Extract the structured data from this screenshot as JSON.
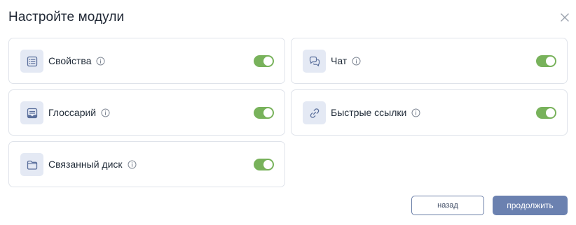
{
  "dialog": {
    "title": "Настройте модули"
  },
  "modules": [
    {
      "label": "Свойства",
      "icon": "list-icon",
      "enabled": true
    },
    {
      "label": "Чат",
      "icon": "chat-icon",
      "enabled": true
    },
    {
      "label": "Глоссарий",
      "icon": "glossary-icon",
      "enabled": true
    },
    {
      "label": "Быстрые ссылки",
      "icon": "link-icon",
      "enabled": true
    },
    {
      "label": "Связанный диск",
      "icon": "folder-icon",
      "enabled": true
    }
  ],
  "footer": {
    "back_label": "назад",
    "continue_label": "продолжить"
  },
  "colors": {
    "toggle_on": "#78b25b",
    "primary_button": "#6b81b0",
    "icon_box": "#e4e9f4",
    "icon_stroke": "#5a6f9c"
  }
}
